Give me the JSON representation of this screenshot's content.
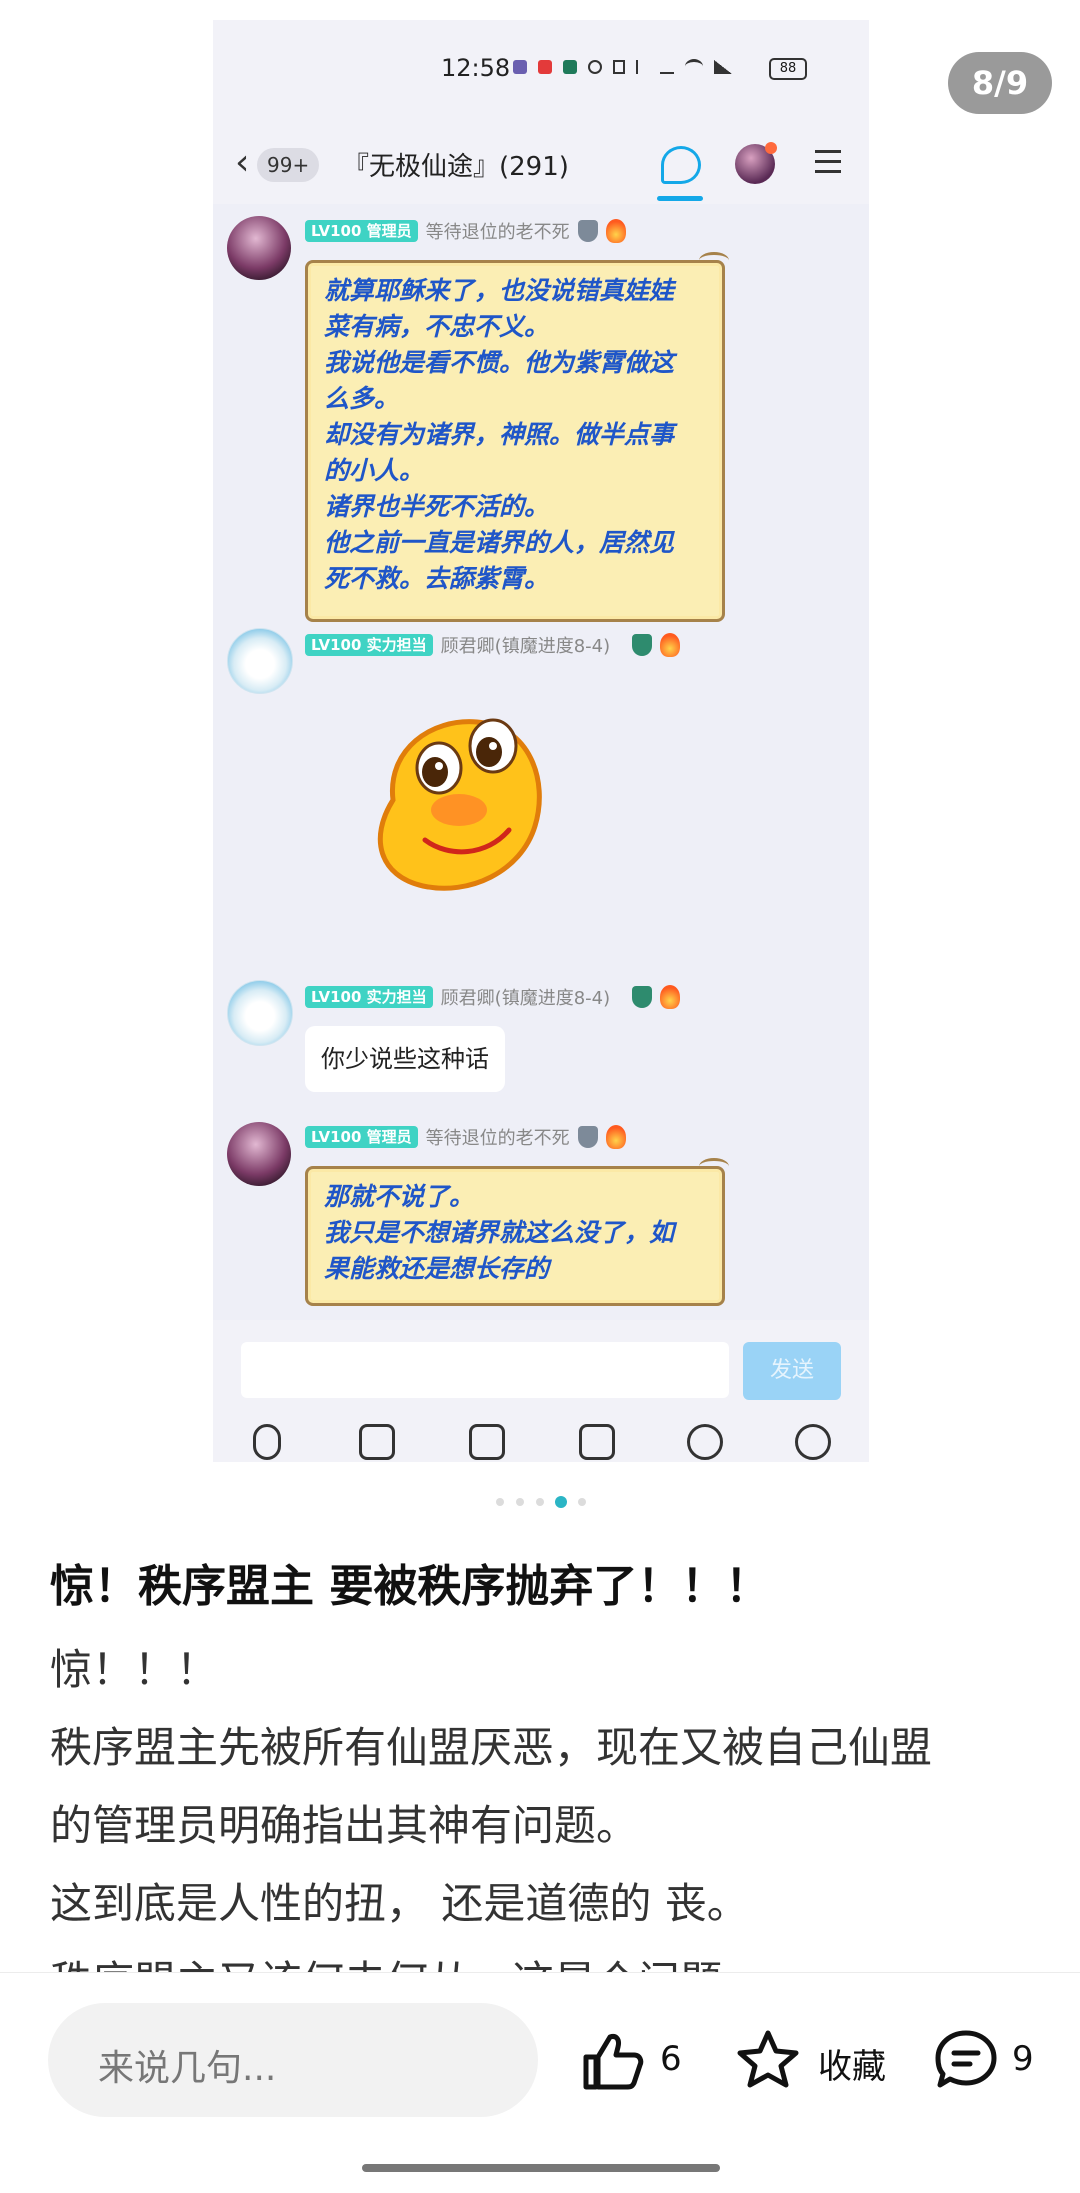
{
  "viewer": {
    "counter": "8/9"
  },
  "chat": {
    "status": {
      "time": "12:58",
      "battery": "88"
    },
    "header": {
      "back_badge": "99+",
      "title": "『无极仙途』(291)"
    },
    "messages": [
      {
        "level": "LV100",
        "role": "管理员",
        "name": "等待退位的老不死",
        "lines": [
          "就算耶稣来了，也没说错真娃娃",
          "菜有病，不忠不义。",
          "我说他是看不惯。他为紫霄做这",
          "么多。",
          "却没有为诸界，神照。做半点事",
          "的小人。",
          "诸界也半死不活的。",
          "他之前一直是诸界的人，居然见",
          "死不救。去舔紫霄。"
        ]
      },
      {
        "level": "LV100",
        "role": "实力担当",
        "name": "顾君卿(镇魔进度8-4)"
      },
      {
        "level": "LV100",
        "role": "实力担当",
        "name": "顾君卿(镇魔进度8-4)",
        "text": "你少说些这种话"
      },
      {
        "level": "LV100",
        "role": "管理员",
        "name": "等待退位的老不死",
        "lines": [
          "那就不说了。",
          "我只是不想诸界就这么没了，如",
          "果能救还是想长存的"
        ]
      }
    ],
    "input": {
      "send": "发送"
    }
  },
  "post": {
    "title": "惊！秩序盟主 要被秩序抛弃了！！！",
    "lines": [
      "惊！！！",
      "秩序盟主先被所有仙盟厌恶，现在又被自己仙盟",
      "的管理员明确指出其神有问题。",
      "这到底是人性的扭， 还是道德的 丧。",
      "秩序盟主又该何去何从，这是个问题"
    ]
  },
  "bottom": {
    "comment_placeholder": "来说几句...",
    "likes": "6",
    "favorite": "收藏",
    "comments": "9"
  },
  "colors": {
    "accent": "#2bb5c5",
    "bubble_text": "#1f56c8",
    "send_btn": "#9ad3f6"
  },
  "icons": [
    "mic-icon",
    "image-icon",
    "camera-icon",
    "file-icon",
    "emoji-icon",
    "plus-icon",
    "like-icon",
    "star-icon",
    "comment-icon"
  ]
}
